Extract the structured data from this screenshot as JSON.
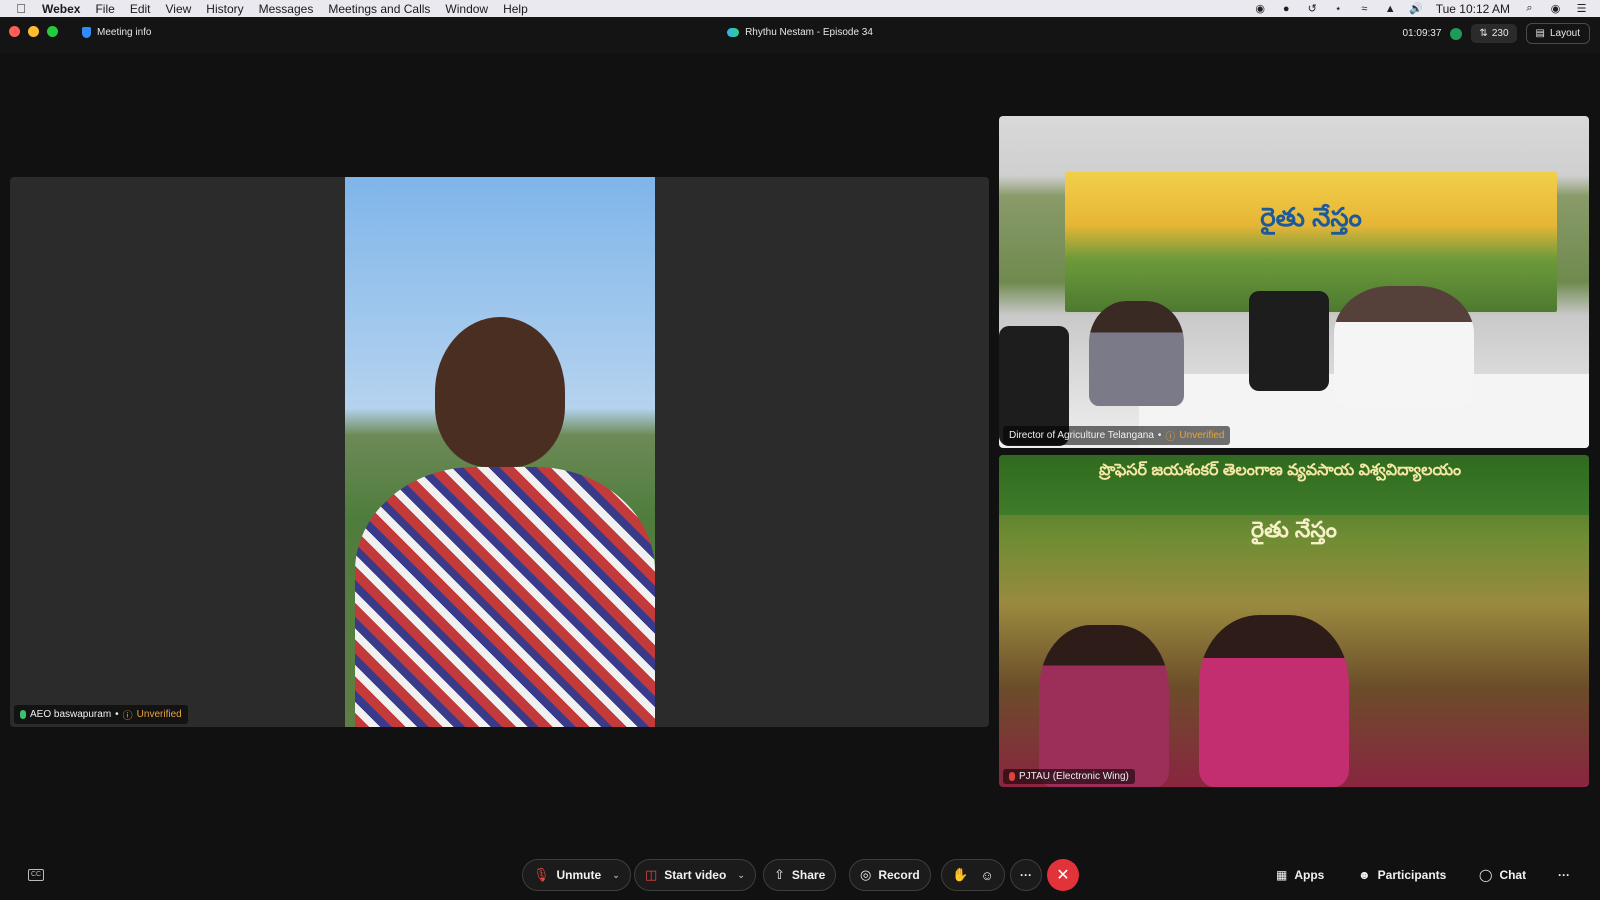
{
  "menubar": {
    "app": "Webex",
    "items": [
      "File",
      "Edit",
      "View",
      "History",
      "Messages",
      "Meetings and Calls",
      "Window",
      "Help"
    ],
    "clock": "Tue 10:12 AM"
  },
  "titlebar": {
    "meeting_info": "Meeting info",
    "title": "Rhythu Nestam - Episode 34",
    "timer": "01:09:37",
    "participant_count": "230",
    "layout": "Layout"
  },
  "tiles": {
    "main": {
      "name": "AEO baswapuram",
      "status": "Unverified"
    },
    "top_right": {
      "name": "Director of Agriculture Telangana",
      "status": "Unverified",
      "banner_text": "రైతు నేస్తం"
    },
    "bottom_right": {
      "name": "PJTAU (Electronic Wing)",
      "banner_top": "ప్రొఫెసర్ జయశంకర్ తెలంగాణ వ్యవసాయ విశ్వవిద్యాలయం",
      "banner_mid": "రైతు నేస్తం"
    }
  },
  "toolbar": {
    "unmute": "Unmute",
    "start_video": "Start video",
    "share": "Share",
    "record": "Record",
    "more": "···",
    "apps": "Apps",
    "participants": "Participants",
    "chat": "Chat",
    "overflow": "···"
  },
  "colors": {
    "end_call": "#e2323a",
    "unverified": "#e8a53a",
    "mic_live": "#3ac26c",
    "mic_muted": "#e0433c"
  }
}
